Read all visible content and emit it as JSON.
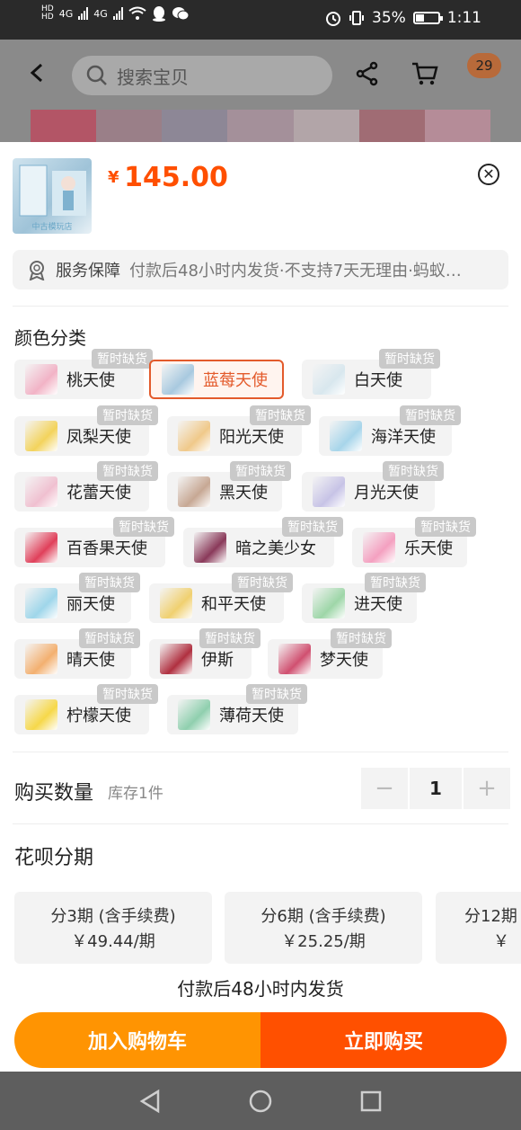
{
  "status_bar": {
    "hd1": "HD",
    "hd2": "HD",
    "net1": "4G",
    "net2": "4G",
    "battery_percent": "35%",
    "time": "1:11"
  },
  "header": {
    "search_placeholder": "搜索宝贝",
    "cart_count": "29"
  },
  "product": {
    "thumb_caption": "中古模玩店",
    "currency": "¥",
    "price": "145.00"
  },
  "service": {
    "label": "服务保障",
    "text": "付款后48小时内发货·不支持7天无理由·蚂蚁…"
  },
  "color_section": {
    "title": "颜色分类",
    "out_of_stock_tag": "暂时缺货",
    "options": [
      {
        "label": "桃天使",
        "color": "#f2b3c6",
        "out_of_stock": true,
        "selected": false
      },
      {
        "label": "蓝莓天使",
        "color": "#a8c9df",
        "out_of_stock": false,
        "selected": true
      },
      {
        "label": "白天使",
        "color": "#d8e7ee",
        "out_of_stock": true,
        "selected": false
      },
      {
        "label": "凤梨天使",
        "color": "#f3d35c",
        "out_of_stock": true,
        "selected": false
      },
      {
        "label": "阳光天使",
        "color": "#f0c98a",
        "out_of_stock": true,
        "selected": false
      },
      {
        "label": "海洋天使",
        "color": "#a7d5ea",
        "out_of_stock": true,
        "selected": false
      },
      {
        "label": "花蕾天使",
        "color": "#f0c0d0",
        "out_of_stock": true,
        "selected": false
      },
      {
        "label": "黑天使",
        "color": "#c7a894",
        "out_of_stock": true,
        "selected": false
      },
      {
        "label": "月光天使",
        "color": "#c7c3e6",
        "out_of_stock": true,
        "selected": false
      },
      {
        "label": "百香果天使",
        "color": "#e0405a",
        "out_of_stock": true,
        "selected": false
      },
      {
        "label": "暗之美少女",
        "color": "#8a3a5a",
        "out_of_stock": true,
        "selected": false
      },
      {
        "label": "乐天使",
        "color": "#f4a0c0",
        "out_of_stock": true,
        "selected": false
      },
      {
        "label": "丽天使",
        "color": "#9fd6ea",
        "out_of_stock": true,
        "selected": false
      },
      {
        "label": "和平天使",
        "color": "#f0d070",
        "out_of_stock": true,
        "selected": false
      },
      {
        "label": "进天使",
        "color": "#9ed6a8",
        "out_of_stock": true,
        "selected": false
      },
      {
        "label": "晴天使",
        "color": "#f3b070",
        "out_of_stock": true,
        "selected": false
      },
      {
        "label": "伊斯",
        "color": "#b03040",
        "out_of_stock": true,
        "selected": false
      },
      {
        "label": "梦天使",
        "color": "#d05070",
        "out_of_stock": true,
        "selected": false
      },
      {
        "label": "柠檬天使",
        "color": "#f6d84a",
        "out_of_stock": true,
        "selected": false
      },
      {
        "label": "薄荷天使",
        "color": "#8fcfae",
        "out_of_stock": true,
        "selected": false
      }
    ]
  },
  "quantity": {
    "label": "购买数量",
    "stock": "库存1件",
    "value": "1",
    "minus": "−",
    "plus": "+"
  },
  "installments": {
    "title": "花呗分期",
    "plans": [
      {
        "period": "分3期 (含手续费)",
        "amount": "￥49.44/期"
      },
      {
        "period": "分6期 (含手续费)",
        "amount": "￥25.25/期"
      },
      {
        "period": "分12期",
        "amount": "￥"
      }
    ]
  },
  "ship_note": "付款后48小时内发货",
  "actions": {
    "add_to_cart": "加入购物车",
    "buy_now": "立即购买"
  },
  "colors": {
    "accent_orange": "#ff5000",
    "cart_button": "#ff9402",
    "selected_border": "#e35a2b"
  }
}
